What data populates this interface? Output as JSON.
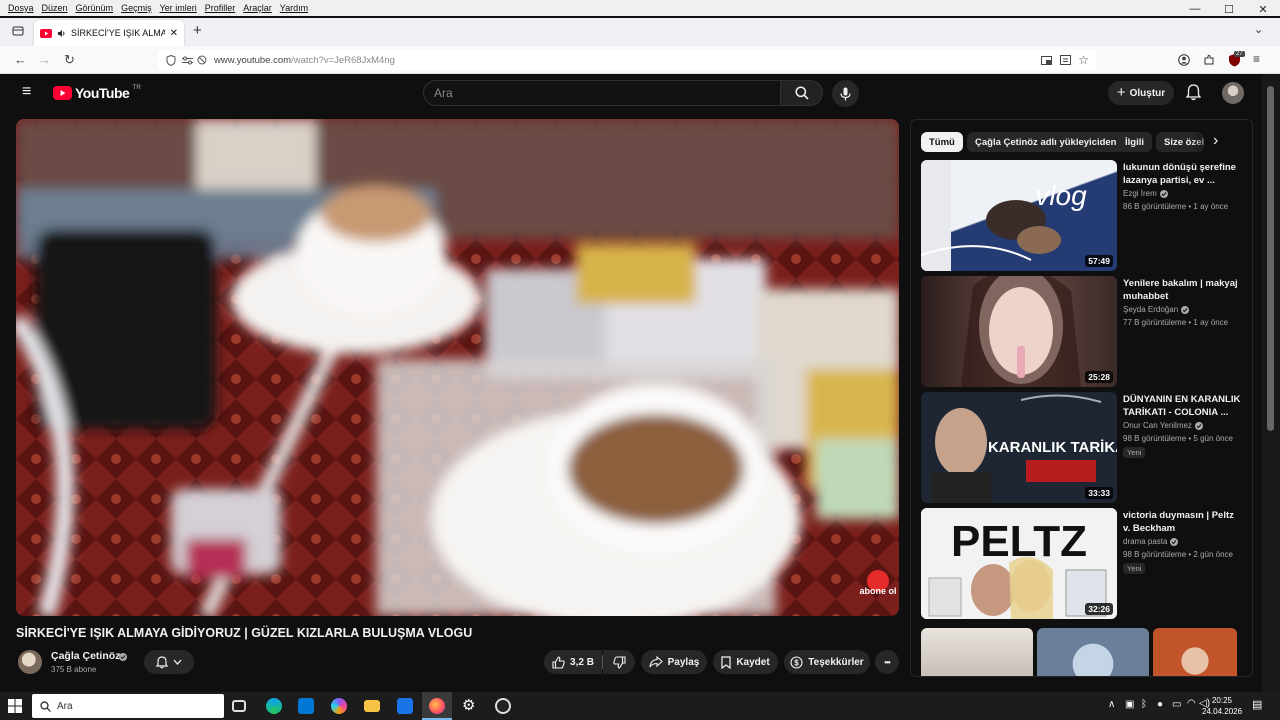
{
  "menubar": {
    "items": [
      "Dosya",
      "Düzen",
      "Görünüm",
      "Geçmiş",
      "Yer imleri",
      "Profiller",
      "Araçlar",
      "Yardım"
    ]
  },
  "window_controls": {
    "minimize": "—",
    "maximize": "☐",
    "close": "✕"
  },
  "browser": {
    "tab_title": "SİRKECİ'YE IŞIK ALMAYA GİDİYORUZ",
    "new_tab": "+",
    "url_host": "www.youtube.com",
    "url_path": "/watch?v=JeR68JxM4ng",
    "extension_badge": "27"
  },
  "youtube": {
    "logo_text": "YouTube",
    "logo_region": "TR",
    "search_placeholder": "Ara",
    "create_label": "Oluştur"
  },
  "video": {
    "title": "SİRKECİ'YE IŞIK ALMAYA GİDİYORUZ | GÜZEL KIZLARLA BULUŞMA VLOGU",
    "watermark": "abone ol",
    "channel_name": "Çağla Çetinöz",
    "subscribers": "375 B abone",
    "likes": "3,2 B",
    "share_label": "Paylaş",
    "save_label": "Kaydet",
    "thanks_label": "Teşekkürler",
    "more": "•••"
  },
  "chips": [
    "Tümü",
    "Çağla Çetinöz adlı yükleyiciden",
    "İlgili",
    "Size özel"
  ],
  "recommendations": [
    {
      "title": "lukunun dönüşü şerefine lazanya partisi, ev ...",
      "channel": "Ezgi İrem",
      "meta": "86 B görüntüleme • 1 ay önce",
      "duration": "57:49",
      "thumb_text": "vlog",
      "new_badge": ""
    },
    {
      "title": "Yenilere bakalım | makyaj muhabbet",
      "channel": "Şeyda Erdoğan",
      "meta": "77 B görüntüleme • 1 ay önce",
      "duration": "25:28",
      "thumb_text": "",
      "new_badge": ""
    },
    {
      "title": "DÜNYANIN EN KARANLIK TARİKATI - COLONIA ...",
      "channel": "Onur Can Yenilmez",
      "meta": "98 B görüntüleme • 5 gün önce",
      "duration": "33:33",
      "thumb_text": "KARANLIK TARİKAT",
      "new_badge": "Yeni"
    },
    {
      "title": "victoria duymasın | Peltz v. Beckham",
      "channel": "drama pasta",
      "meta": "98 B görüntüleme • 2 gün önce",
      "duration": "32:26",
      "thumb_text": "PELTZ",
      "new_badge": "Yeni"
    }
  ],
  "taskbar": {
    "search_placeholder": "Ara",
    "time": "20:25",
    "date": "24.04.2026"
  },
  "colors": {
    "yt_red": "#ff0033",
    "bg_dark": "#0f0f0f",
    "chip_bg": "#272727"
  }
}
